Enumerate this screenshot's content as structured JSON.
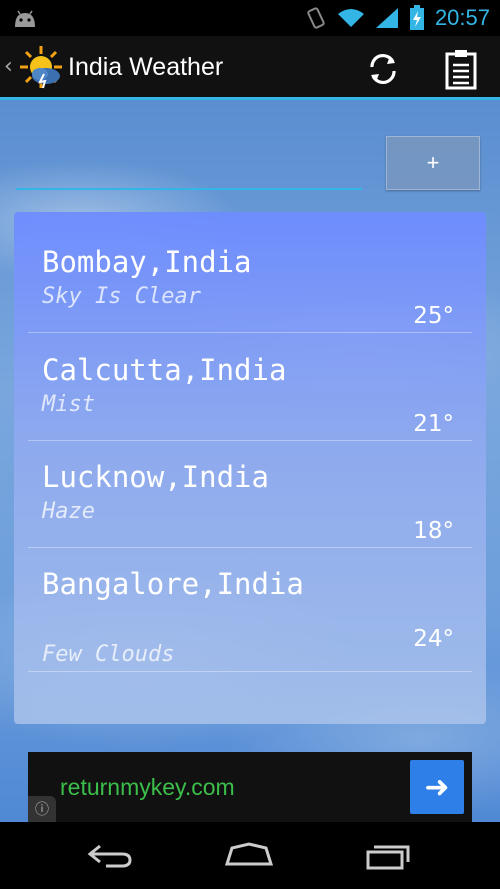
{
  "status_bar": {
    "time": "20:57",
    "icons": [
      "android-icon",
      "vibrate-icon",
      "wifi-icon",
      "signal-icon",
      "battery-charging-icon"
    ]
  },
  "action_bar": {
    "title": "India Weather",
    "icons": [
      "up-chevron-icon",
      "app-logo-sun-cloud-icon",
      "refresh-icon",
      "clipboard-icon"
    ]
  },
  "search": {
    "value": "",
    "placeholder": "",
    "add_label": "+"
  },
  "cities": [
    {
      "name": "Bombay,India",
      "description": "Sky Is Clear",
      "temperature": "25°"
    },
    {
      "name": "Calcutta,India",
      "description": "Mist",
      "temperature": "21°"
    },
    {
      "name": "Lucknow,India",
      "description": "Haze",
      "temperature": "18°"
    },
    {
      "name": "Bangalore,India",
      "description": "Few Clouds",
      "temperature": "24°"
    }
  ],
  "ad": {
    "text": "returnmykey.com",
    "info_icon": "info-icon",
    "arrow_icon": "arrow-right-icon"
  },
  "nav_bar": {
    "icons": [
      "back-icon",
      "home-icon",
      "recent-apps-icon"
    ]
  },
  "colors": {
    "accent": "#33b5e5",
    "ad_text": "#3cbf4a",
    "ad_button": "#2f7fe8"
  }
}
